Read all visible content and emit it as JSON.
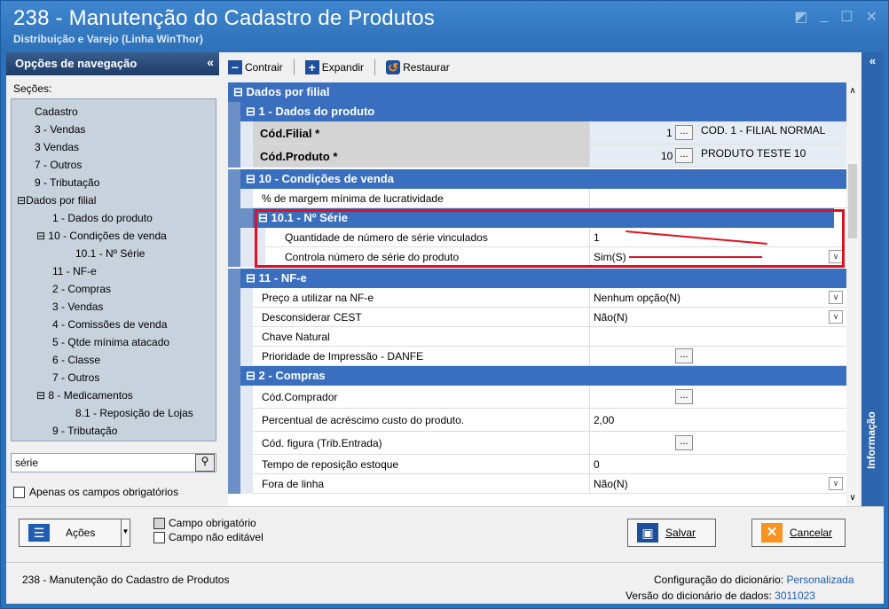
{
  "window": {
    "title": "238 - Manutenção do Cadastro de Produtos",
    "subtitle": "Distribuição e Varejo (Linha WinThor)"
  },
  "nav": {
    "header": "Opções de navegação",
    "secoes_label": "Seções:",
    "tree": [
      "Cadastro",
      "3 - Vendas",
      "3 Vendas",
      "7 - Outros",
      "9 - Tributação",
      "Dados por filial",
      "1 - Dados do produto",
      "10 - Condições de venda",
      "10.1 - Nº Série",
      "11 - NF-e",
      "2 - Compras",
      "3 - Vendas",
      "4 - Comissões de venda",
      "5 - Qtde mínima atacado",
      "6 - Classe",
      "7 - Outros",
      "8 - Medicamentos",
      "8.1 -  Reposição de Lojas",
      "9 - Tributação"
    ],
    "search_value": "série",
    "only_required_label": "Apenas os campos obrigatórios"
  },
  "toolbar": {
    "collapse": "Contrair",
    "expand": "Expandir",
    "restore": "Restaurar"
  },
  "grid": {
    "dados_por_filial": "Dados por filial",
    "dados_produto": "1 - Dados do produto",
    "cod_filial_label": "Cód.Filial *",
    "cod_filial_value": "1",
    "cod_filial_desc": "COD. 1 - FILIAL NORMAL",
    "cod_produto_label": "Cód.Produto *",
    "cod_produto_value": "10",
    "cod_produto_desc": "PRODUTO TESTE 10",
    "condicoes_venda": "10 - Condições de venda",
    "margem_label": "% de margem mínima de lucratividade",
    "nserie": "10.1 - Nº Série",
    "qtd_serie_label": "Quantidade de número de série vinculados",
    "qtd_serie_value": "1",
    "controla_label": "Controla número de série do produto",
    "controla_value": "Sim(S)",
    "nfe": "11 - NF-e",
    "preco_label": "Preço a utilizar na NF-e",
    "preco_value": "Nenhum opção(N)",
    "cest_label": "Desconsiderar CEST",
    "cest_value": "Não(N)",
    "chave_label": "Chave Natural",
    "prioridade_label": "Prioridade de Impressão - DANFE",
    "compras": "2 - Compras",
    "comprador_label": "Cód.Comprador",
    "percentual_label": "Percentual de acréscimo custo do produto.",
    "percentual_value": "2,00",
    "figura_label": "Cód. figura (Trib.Entrada)",
    "tempo_label": "Tempo de reposição estoque",
    "tempo_value": "0",
    "fora_label": "Fora de linha",
    "fora_value": "Não(N)"
  },
  "info_tab": "Informação",
  "bottom": {
    "acoes": "Ações",
    "legend_required": "Campo obrigatório",
    "legend_noedit": "Campo não editável",
    "salvar": "Salvar",
    "cancelar": "Cancelar"
  },
  "status": {
    "left": "238 - Manutenção do Cadastro de Produtos",
    "config_label": "Configuração do dicionário:",
    "config_value": "Personalizada",
    "versao_label": "Versão do dicionário de dados:",
    "versao_value": "3011023"
  },
  "colors": {
    "highlight": "#e01020",
    "section": "#3a6fc0"
  }
}
